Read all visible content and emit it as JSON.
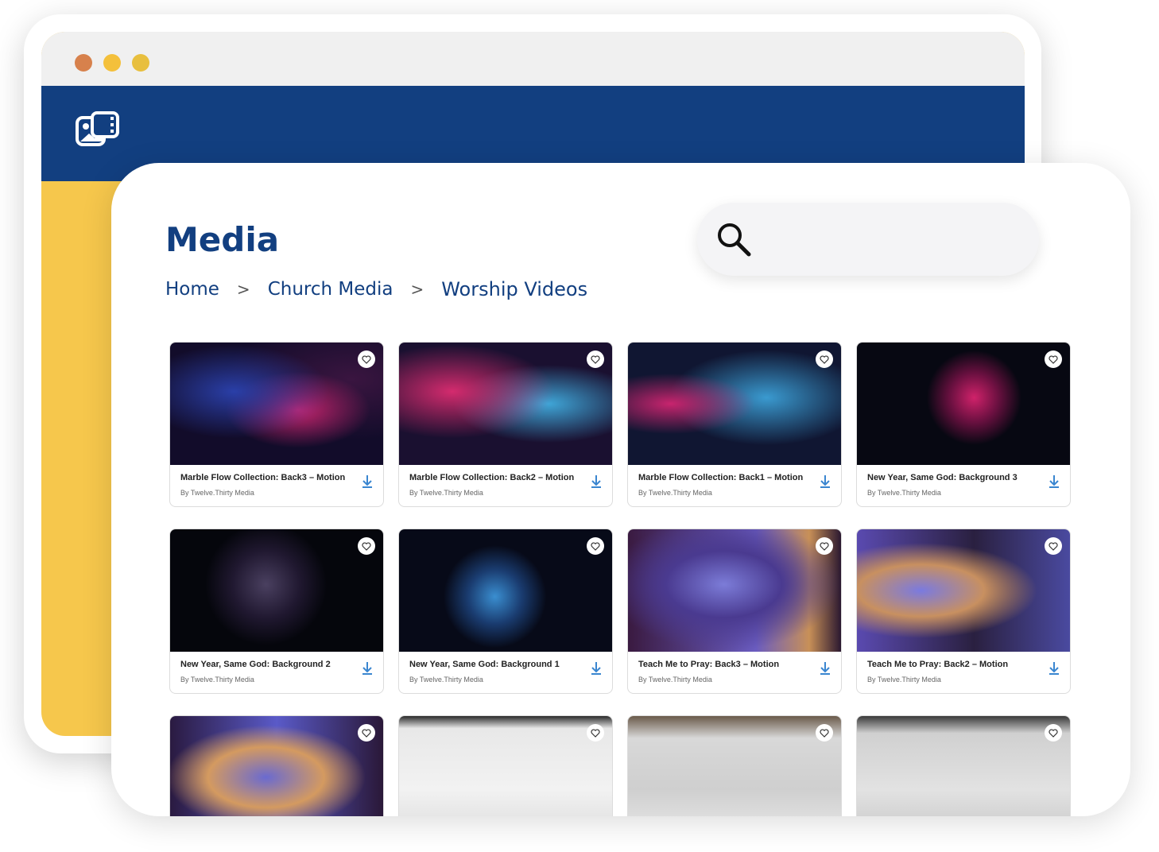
{
  "window": {
    "controls": [
      "close",
      "minimize",
      "maximize"
    ],
    "logo_icon": "media-gallery-icon"
  },
  "page": {
    "title": "Media",
    "breadcrumb": [
      "Home",
      "Church Media",
      "Worship Videos"
    ],
    "breadcrumb_separator": ">"
  },
  "search": {
    "placeholder": "",
    "value": ""
  },
  "cards": [
    {
      "title": "Marble Flow Collection: Back3 – Motion",
      "author": "By Twelve.Thirty Media",
      "thumb": "t-marble3"
    },
    {
      "title": "Marble Flow Collection: Back2 – Motion",
      "author": "By Twelve.Thirty Media",
      "thumb": "t-marble2"
    },
    {
      "title": "Marble Flow Collection: Back1 – Motion",
      "author": "By Twelve.Thirty Media",
      "thumb": "t-marble1"
    },
    {
      "title": "New Year, Same God: Background 3",
      "author": "By Twelve.Thirty Media",
      "thumb": "t-fire3"
    },
    {
      "title": "New Year, Same God: Background 2",
      "author": "By Twelve.Thirty Media",
      "thumb": "t-fire2"
    },
    {
      "title": "New Year, Same God: Background 1",
      "author": "By Twelve.Thirty Media",
      "thumb": "t-fire1"
    },
    {
      "title": "Teach Me to Pray: Back3 – Motion",
      "author": "By Twelve.Thirty Media",
      "thumb": "t-pray3"
    },
    {
      "title": "Teach Me to Pray: Back2 – Motion",
      "author": "By Twelve.Thirty Media",
      "thumb": "t-pray2"
    },
    {
      "title": "",
      "author": "",
      "thumb": "t-pray1"
    },
    {
      "title": "",
      "author": "",
      "thumb": "t-snow1"
    },
    {
      "title": "",
      "author": "",
      "thumb": "t-snow2"
    },
    {
      "title": "",
      "author": "",
      "thumb": "t-snow3"
    }
  ],
  "colors": {
    "brand_blue": "#123f80",
    "accent_yellow": "#f6c74c",
    "download_blue": "#3a86d0"
  }
}
